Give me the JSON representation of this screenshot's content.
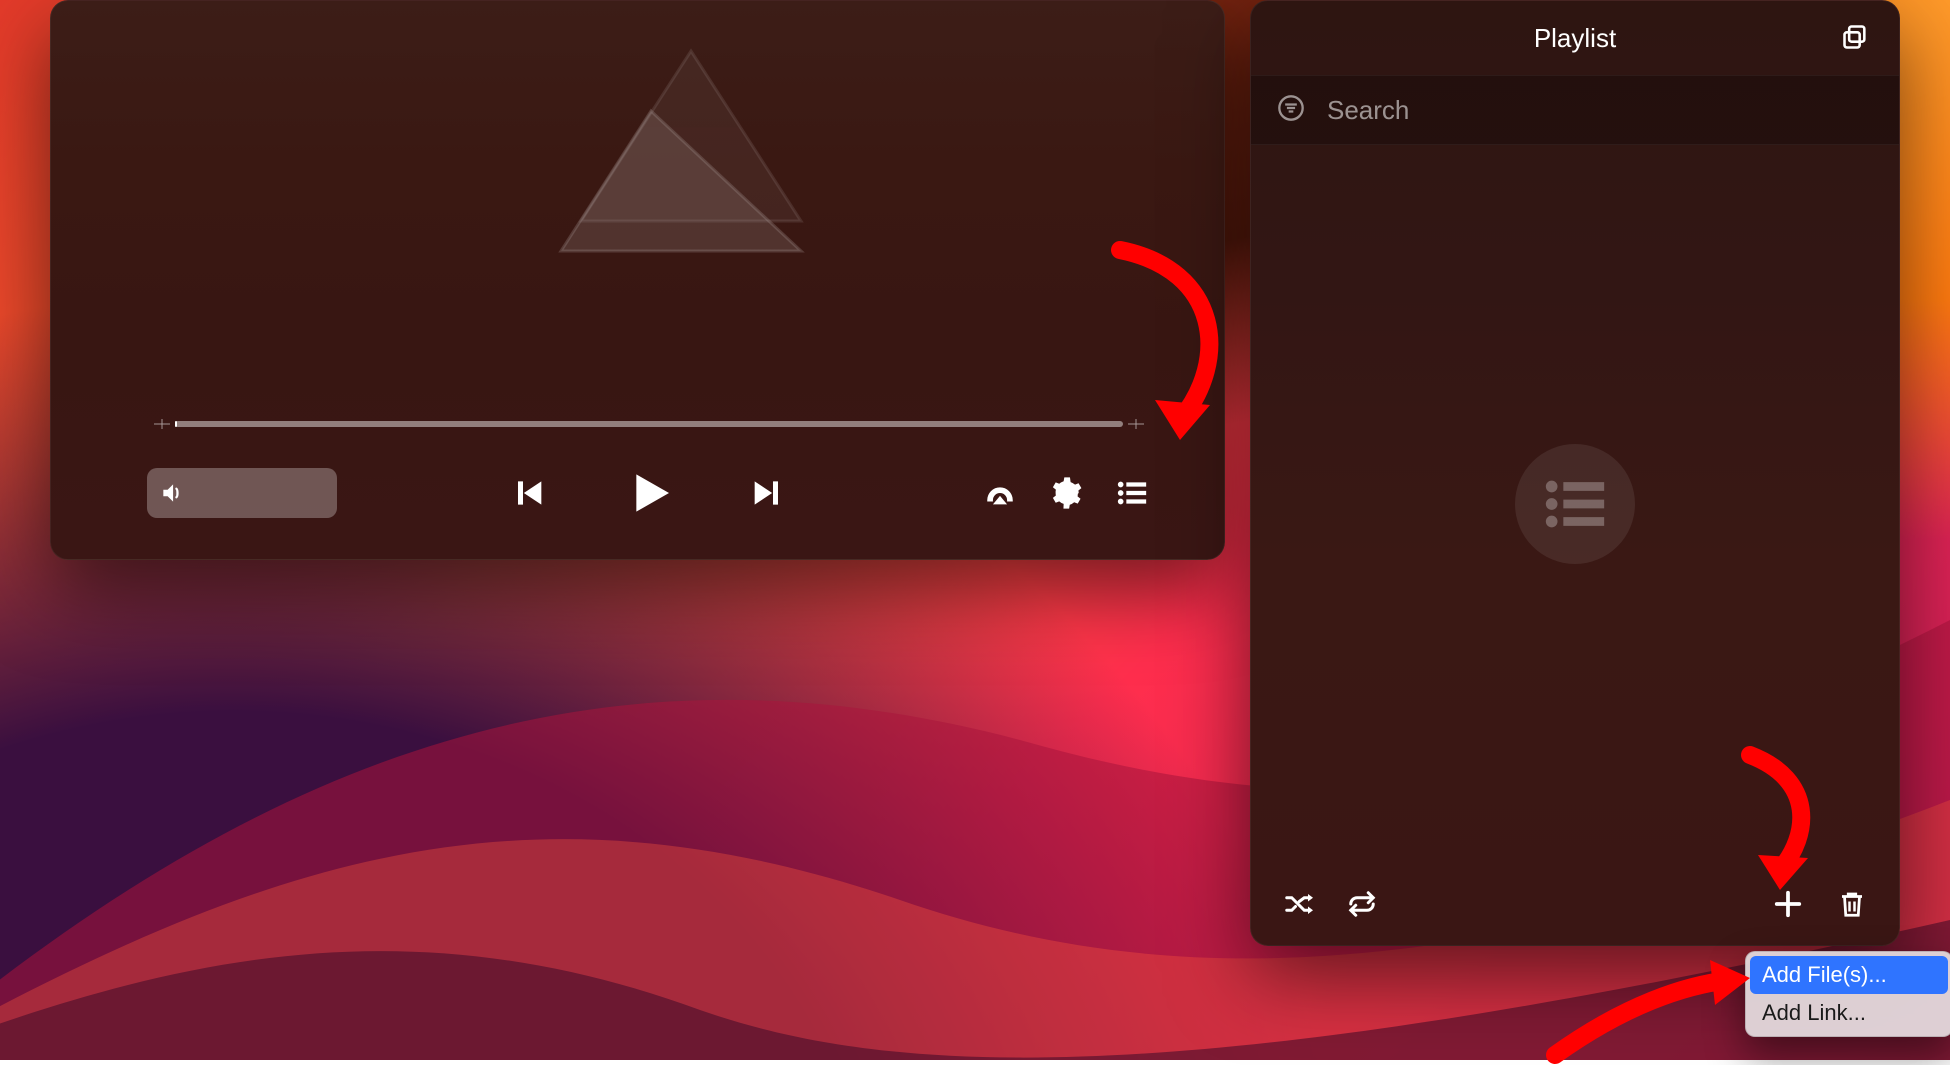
{
  "player": {
    "volume_level": 1.0,
    "progress": 0
  },
  "playlist_panel": {
    "title": "Playlist",
    "search_placeholder": "Search"
  },
  "context_menu": {
    "items": [
      {
        "label": "Add File(s)...",
        "selected": true
      },
      {
        "label": "Add Link...",
        "selected": false
      }
    ]
  },
  "colors": {
    "annotation": "#ff0000",
    "menu_highlight": "#2f74ff"
  }
}
